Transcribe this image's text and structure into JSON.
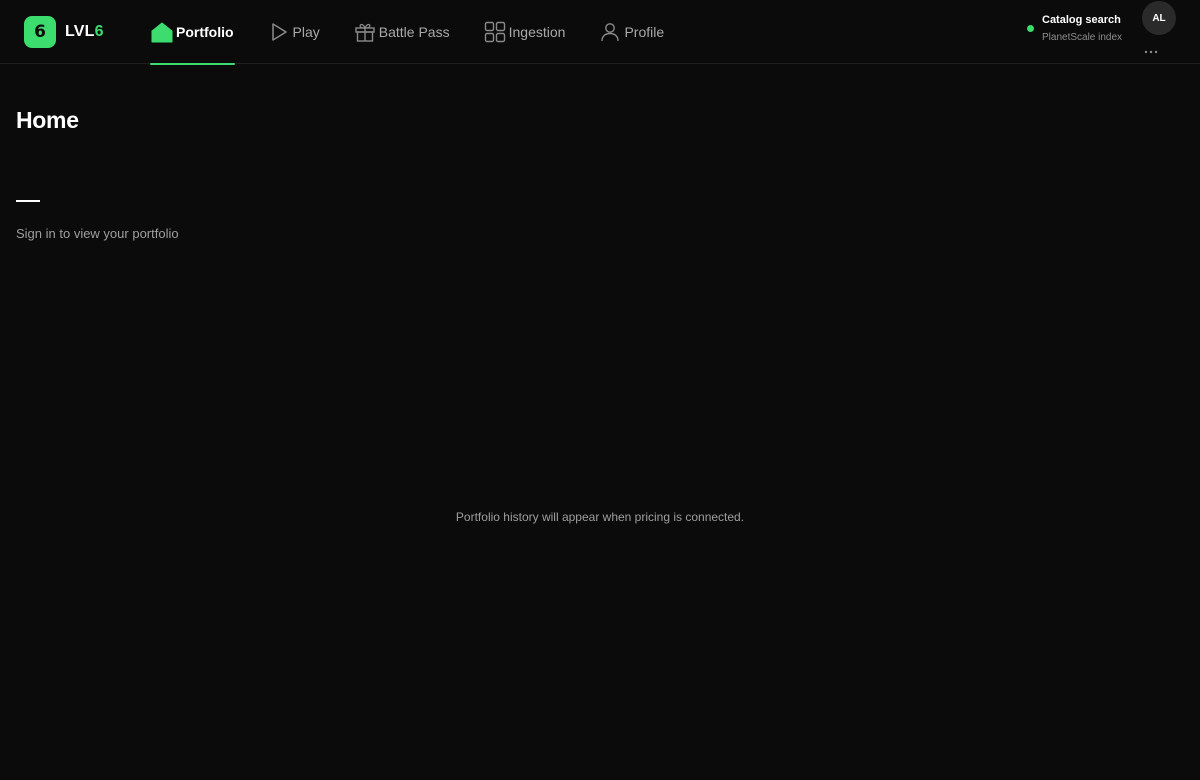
{
  "brand": {
    "badge": "6",
    "name_prefix": "LVL",
    "name_suffix": "6",
    "badge_color": "#3ddc6f",
    "suffix_color": "#3ddc6f"
  },
  "nav": {
    "items": [
      {
        "label": "Portfolio",
        "icon": "home-icon",
        "active": true
      },
      {
        "label": "Play",
        "icon": "play-icon",
        "active": false
      },
      {
        "label": "Battle Pass",
        "icon": "gift-icon",
        "active": false
      },
      {
        "label": "Ingestion",
        "icon": "grid-icon",
        "active": false
      },
      {
        "label": "Profile",
        "icon": "user-icon",
        "active": false
      }
    ],
    "accent": "#3ddc6f"
  },
  "catalog": {
    "title": "Catalog search",
    "subtitle": "PlanetScale index",
    "status_color": "#3ddc6f"
  },
  "user": {
    "initials": "AL"
  },
  "main": {
    "title": "Home",
    "value": "—",
    "signin_message": "Sign in to view your portfolio",
    "chart_empty_message": "Portfolio history will appear when pricing is connected."
  }
}
